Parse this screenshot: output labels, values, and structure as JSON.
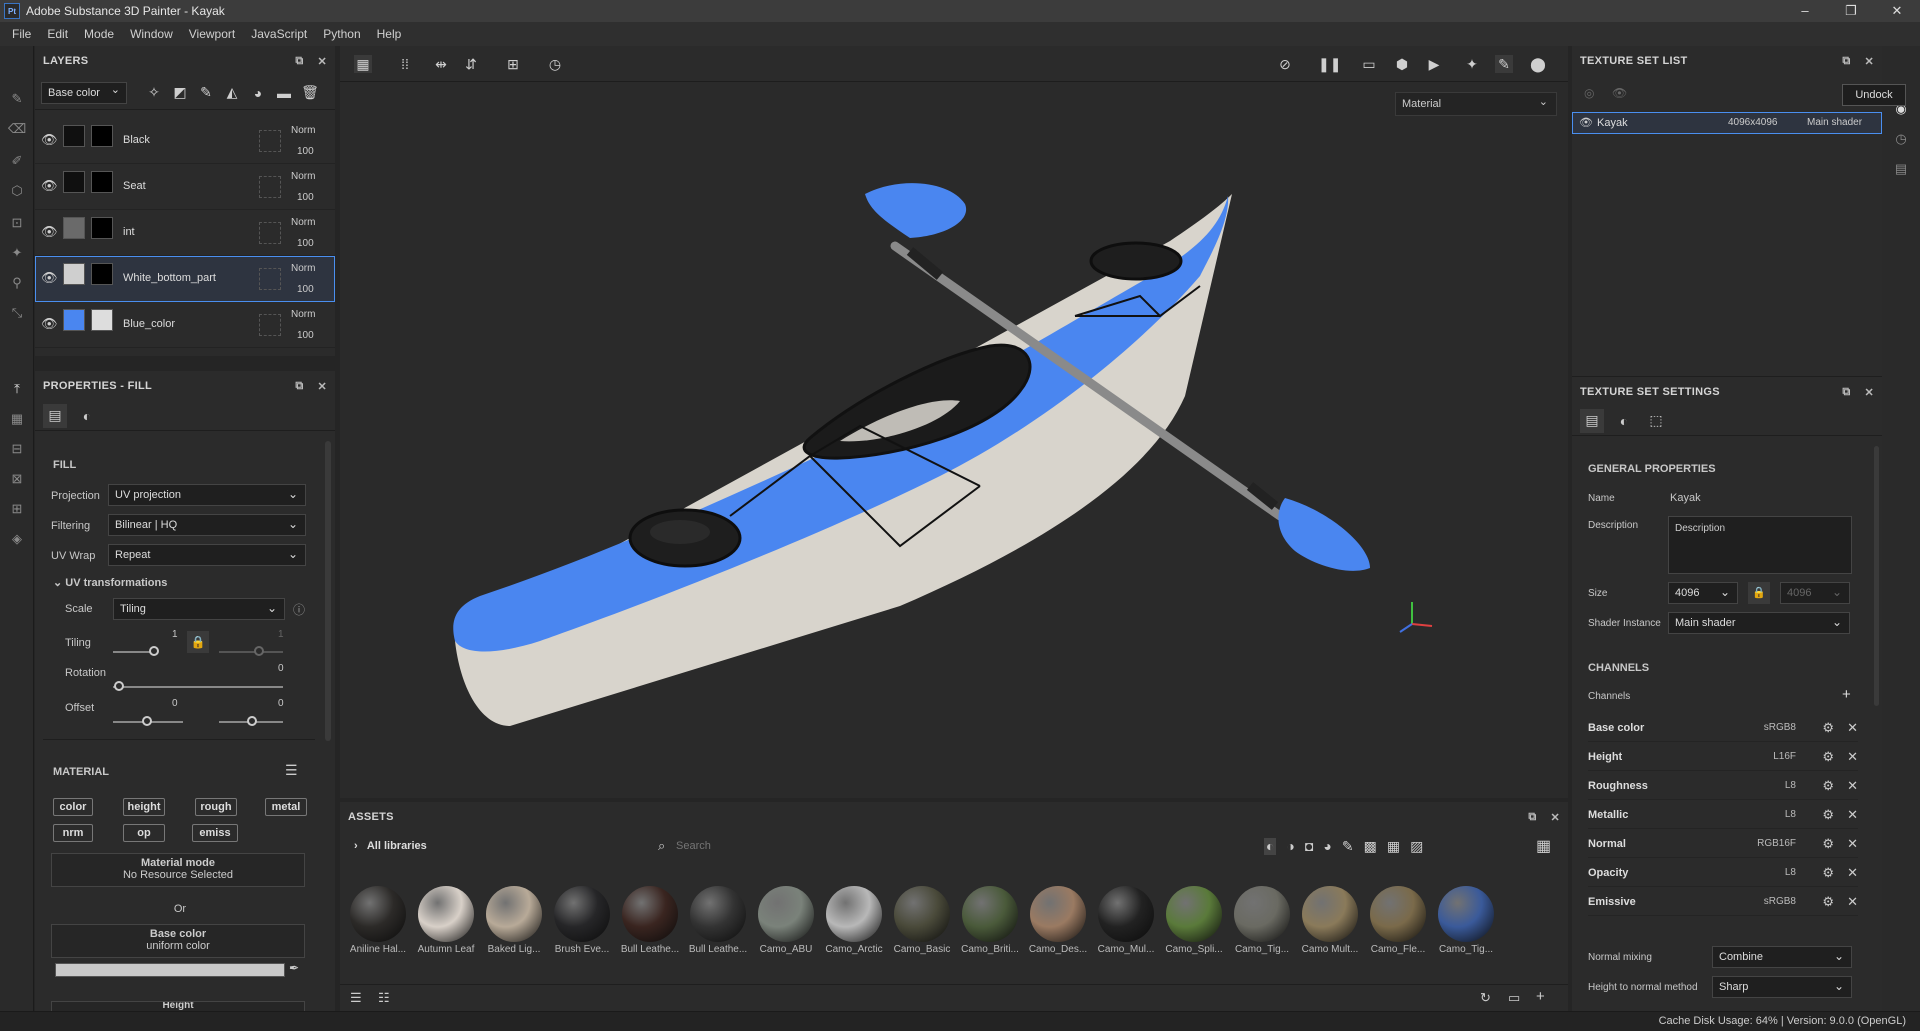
{
  "window": {
    "title": "Adobe Substance 3D Painter - Kayak",
    "logo": "Pt"
  },
  "menu": [
    "File",
    "Edit",
    "Mode",
    "Window",
    "Viewport",
    "JavaScript",
    "Python",
    "Help"
  ],
  "layers_panel": {
    "title": "LAYERS",
    "channel": "Base color",
    "layers": [
      {
        "name": "Black",
        "blend": "Norm",
        "opacity": "100",
        "color": "#101010"
      },
      {
        "name": "Seat",
        "blend": "Norm",
        "opacity": "100",
        "color": "#101010"
      },
      {
        "name": "int",
        "blend": "Norm",
        "opacity": "100",
        "color": "#6a6a6a"
      },
      {
        "name": "White_bottom_part",
        "blend": "Norm",
        "opacity": "100",
        "color": "#cfcfcf"
      },
      {
        "name": "Blue_color",
        "blend": "Norm",
        "opacity": "100",
        "color": "#4a86f0"
      }
    ]
  },
  "properties": {
    "title": "PROPERTIES - FILL",
    "fill_label": "FILL",
    "projection_label": "Projection",
    "projection": "UV projection",
    "filtering_label": "Filtering",
    "filtering": "Bilinear | HQ",
    "uvwrap_label": "UV Wrap",
    "uvwrap": "Repeat",
    "uvt_label": "UV transformations",
    "scale_label": "Scale",
    "scale": "Tiling",
    "tiling_label": "Tiling",
    "tiling_u": "1",
    "tiling_v": "1",
    "rotation_label": "Rotation",
    "rotation": "0",
    "offset_label": "Offset",
    "offset_u": "0",
    "offset_v": "0",
    "material_label": "MATERIAL",
    "chips": [
      "color",
      "height",
      "rough",
      "metal",
      "nrm",
      "op",
      "emiss"
    ],
    "material_mode_label": "Material mode",
    "material_mode_value": "No Resource Selected",
    "or_label": "Or",
    "base_color_label": "Base color",
    "base_color_value": "uniform color",
    "height_label": "Height"
  },
  "viewport": {
    "material_select": "Material"
  },
  "assets": {
    "title": "ASSETS",
    "library": "All libraries",
    "search_placeholder": "Search",
    "items": [
      {
        "name": "Aniline Hal...",
        "color": "#2c2a28"
      },
      {
        "name": "Autumn Leaf",
        "color": "#d8d0c8"
      },
      {
        "name": "Baked Lig...",
        "color": "#b8aa98"
      },
      {
        "name": "Brush Eve...",
        "color": "#262628"
      },
      {
        "name": "Bull Leathe...",
        "color": "#3a2520"
      },
      {
        "name": "Bull Leathe...",
        "color": "#333333"
      },
      {
        "name": "Camo_ABU",
        "color": "#7a827a"
      },
      {
        "name": "Camo_Arctic",
        "color": "#b8b8b8"
      },
      {
        "name": "Camo_Basic",
        "color": "#4a4a3a"
      },
      {
        "name": "Camo_Briti...",
        "color": "#4a5a3a"
      },
      {
        "name": "Camo_Des...",
        "color": "#9a7a62"
      },
      {
        "name": "Camo_Mul...",
        "color": "#222222"
      },
      {
        "name": "Camo_Spli...",
        "color": "#5a7a3a"
      },
      {
        "name": "Camo_Tig...",
        "color": "#6a6a62"
      },
      {
        "name": "Camo Mult...",
        "color": "#8a7a5a"
      },
      {
        "name": "Camo_Fle...",
        "color": "#7a6a4a"
      },
      {
        "name": "Camo_Tig...",
        "color": "#3a5a9a"
      }
    ]
  },
  "texture_set_list": {
    "title": "TEXTURE SET LIST",
    "tooltip": "Undock",
    "row": {
      "name": "Kayak",
      "size": "4096x4096",
      "shader": "Main shader"
    }
  },
  "texture_set_settings": {
    "title": "TEXTURE SET SETTINGS",
    "general_label": "GENERAL PROPERTIES",
    "name_label": "Name",
    "name": "Kayak",
    "description_label": "Description",
    "description": "Description",
    "size_label": "Size",
    "size": "4096",
    "size2": "4096",
    "shader_label": "Shader Instance",
    "shader": "Main shader",
    "channels_header": "CHANNELS",
    "channels_label": "Channels",
    "channels": [
      {
        "name": "Base color",
        "format": "sRGB8"
      },
      {
        "name": "Height",
        "format": "L16F"
      },
      {
        "name": "Roughness",
        "format": "L8"
      },
      {
        "name": "Metallic",
        "format": "L8"
      },
      {
        "name": "Normal",
        "format": "RGB16F"
      },
      {
        "name": "Opacity",
        "format": "L8"
      },
      {
        "name": "Emissive",
        "format": "sRGB8"
      }
    ],
    "normal_mixing_label": "Normal mixing",
    "normal_mixing": "Combine",
    "h2n_label": "Height to normal method",
    "h2n": "Sharp"
  },
  "status": "Cache Disk Usage:   64% | Version: 9.0.0 (OpenGL)",
  "colors": {
    "accent": "#4a8ff0",
    "kayak_blue": "#4a86f0"
  }
}
